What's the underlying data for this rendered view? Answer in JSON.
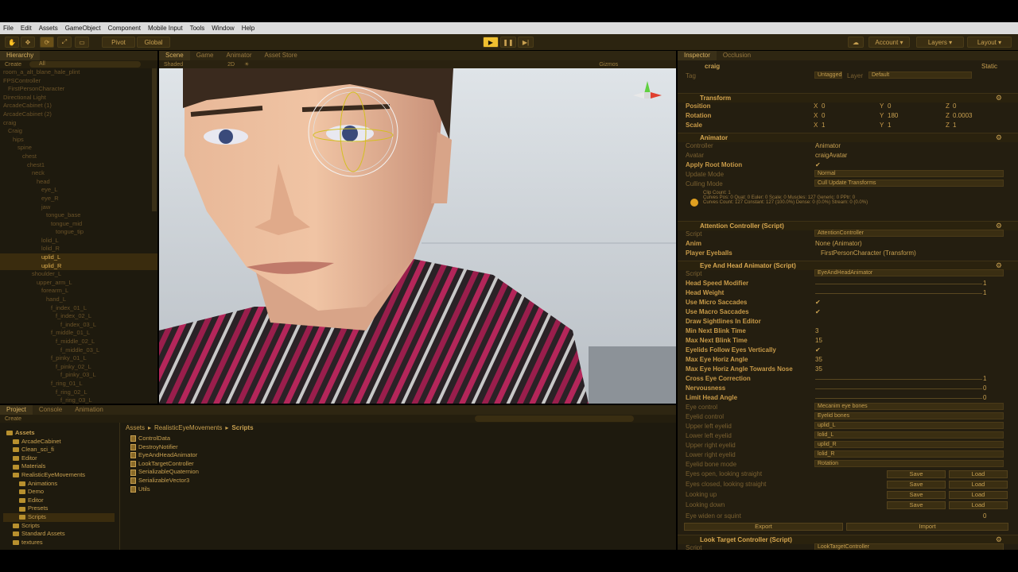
{
  "menubar": {
    "items": [
      "File",
      "Edit",
      "Assets",
      "GameObject",
      "Component",
      "Mobile Input",
      "Tools",
      "Window",
      "Help"
    ]
  },
  "toolbar": {
    "pivot": "Pivot",
    "global": "Global",
    "account": "Account",
    "layers": "Layers",
    "layout": "Layout"
  },
  "hierarchy": {
    "tab": "Hierarchy",
    "create": "Create",
    "search_placeholder": "All",
    "items": [
      {
        "label": "room_a_alt_blane_hale_plint",
        "indent": 0
      },
      {
        "label": "FPSController",
        "indent": 0
      },
      {
        "label": "FirstPersonCharacter",
        "indent": 1
      },
      {
        "label": "Directional Light",
        "indent": 0
      },
      {
        "label": "ArcadeCabinet (1)",
        "indent": 0
      },
      {
        "label": "ArcadeCabinet (2)",
        "indent": 0
      },
      {
        "label": "craig",
        "indent": 0
      },
      {
        "label": "Craig",
        "indent": 1
      },
      {
        "label": "hips",
        "indent": 2
      },
      {
        "label": "spine",
        "indent": 3
      },
      {
        "label": "chest",
        "indent": 4
      },
      {
        "label": "chest1",
        "indent": 5
      },
      {
        "label": "neck",
        "indent": 6
      },
      {
        "label": "head",
        "indent": 7
      },
      {
        "label": "eye_L",
        "indent": 8
      },
      {
        "label": "eye_R",
        "indent": 8
      },
      {
        "label": "jaw",
        "indent": 8
      },
      {
        "label": "tongue_base",
        "indent": 9
      },
      {
        "label": "tongue_mid",
        "indent": 10
      },
      {
        "label": "tongue_tip",
        "indent": 11
      },
      {
        "label": "lolid_L",
        "indent": 8
      },
      {
        "label": "lolid_R",
        "indent": 8
      },
      {
        "label": "uplid_L",
        "indent": 8,
        "selected": true
      },
      {
        "label": "uplid_R",
        "indent": 8,
        "selected": true
      },
      {
        "label": "shoulder_L",
        "indent": 6
      },
      {
        "label": "upper_arm_L",
        "indent": 7
      },
      {
        "label": "forearm_L",
        "indent": 8
      },
      {
        "label": "hand_L",
        "indent": 9
      },
      {
        "label": "f_index_01_L",
        "indent": 10
      },
      {
        "label": "f_index_02_L",
        "indent": 11
      },
      {
        "label": "f_index_03_L",
        "indent": 12
      },
      {
        "label": "f_middle_01_L",
        "indent": 10
      },
      {
        "label": "f_middle_02_L",
        "indent": 11
      },
      {
        "label": "f_middle_03_L",
        "indent": 12
      },
      {
        "label": "f_pinky_01_L",
        "indent": 10
      },
      {
        "label": "f_pinky_02_L",
        "indent": 11
      },
      {
        "label": "f_pinky_03_L",
        "indent": 12
      },
      {
        "label": "f_ring_01_L",
        "indent": 10
      },
      {
        "label": "f_ring_02_L",
        "indent": 11
      },
      {
        "label": "f_ring_03_L",
        "indent": 12
      }
    ]
  },
  "scene": {
    "tabs": [
      "Scene",
      "Game",
      "Animator",
      "Asset Store"
    ],
    "shaded": "Shaded",
    "mode_2d": "2D",
    "gizmos": "Gizmos"
  },
  "inspector": {
    "tabs": [
      "Inspector",
      "Occlusion"
    ],
    "object_name": "craig",
    "static": "Static",
    "tag_label": "Tag",
    "tag_value": "Untagged",
    "layer_label": "Layer",
    "layer_value": "Default",
    "transform": {
      "title": "Transform",
      "rows": [
        {
          "label": "Position",
          "x": "0",
          "y": "0",
          "z": "0"
        },
        {
          "label": "Rotation",
          "x": "0",
          "y": "180",
          "z": "0.0003"
        },
        {
          "label": "Scale",
          "x": "1",
          "y": "1",
          "z": "1"
        }
      ]
    },
    "animator": {
      "title": "Animator",
      "controller_label": "Controller",
      "controller": "Animator",
      "avatar_label": "Avatar",
      "avatar": "craigAvatar",
      "apply_root_motion": "Apply Root Motion",
      "update_mode_label": "Update Mode",
      "update_mode": "Normal",
      "culling_label": "Culling Mode",
      "culling": "Cull Update Transforms",
      "info1": "Clip Count: 1",
      "info2": "Curves Pos: 0 Quat: 0 Euler: 0 Scale: 0 Muscles: 127 Generic: 0 PPtr: 0",
      "info3": "Curves Count: 127 Constant: 127 (100.0%) Dense: 0 (0.0%) Stream: 0 (0.0%)"
    },
    "attention": {
      "title": "Attention Controller (Script)",
      "script_label": "Script",
      "script": "AttentionController",
      "anim_label": "Anim",
      "anim": "None (Animator)",
      "eyeballs_label": "Player Eyeballs",
      "eyeballs": "FirstPersonCharacter (Transform)"
    },
    "eyehead": {
      "title": "Eye And Head Animator (Script)",
      "script_label": "Script",
      "script": "EyeAndHeadAnimator",
      "rows": [
        {
          "label": "Head Speed Modifier",
          "value": "1"
        },
        {
          "label": "Head Weight",
          "value": "1"
        },
        {
          "label": "Use Micro Saccades",
          "value": "✔"
        },
        {
          "label": "Use Macro Saccades",
          "value": "✔"
        },
        {
          "label": "Draw Sightlines In Editor",
          "value": ""
        },
        {
          "label": "Min Next Blink Time",
          "value": "3"
        },
        {
          "label": "Max Next Blink Time",
          "value": "15"
        },
        {
          "label": "Eyelids Follow Eyes Vertically",
          "value": "✔"
        },
        {
          "label": "Max Eye Horiz Angle",
          "value": "35"
        },
        {
          "label": "Max Eye Horiz Angle Towards Nose",
          "value": "35"
        },
        {
          "label": "Cross Eye Correction",
          "value": "1"
        },
        {
          "label": "Nervousness",
          "value": "0"
        },
        {
          "label": "Limit Head Angle",
          "value": "0"
        }
      ],
      "eye_control_label": "Eye control",
      "eye_control": "Mecanim eye bones",
      "eyelid_control_label": "Eyelid control",
      "eyelid_control": "Eyelid bones",
      "lids": [
        {
          "label": "Upper left eyelid",
          "value": "uplid_L"
        },
        {
          "label": "Lower left eyelid",
          "value": "lolid_L"
        },
        {
          "label": "Upper right eyelid",
          "value": "uplid_R"
        },
        {
          "label": "Lower right eyelid",
          "value": "lolid_R"
        }
      ],
      "bone_mode_label": "Eyelid bone mode",
      "bone_mode": "Rotation",
      "poses": [
        "Eyes open, looking straight",
        "Eyes closed, looking straight",
        "Looking up",
        "Looking down"
      ],
      "save": "Save",
      "load": "Load",
      "widen_label": "Eye widen or squint",
      "widen": "0",
      "export": "Export",
      "import": "Import"
    },
    "looktarget": {
      "title": "Look Target Controller (Script)",
      "script_label": "Script",
      "script": "LookTargetController"
    }
  },
  "project": {
    "tabs": [
      "Project",
      "Console",
      "Animation"
    ],
    "create": "Create",
    "breadcrumb": [
      "Assets",
      "RealisticEyeMovements",
      "Scripts"
    ],
    "tree": [
      {
        "label": "Assets",
        "indent": 0,
        "bold": true
      },
      {
        "label": "ArcadeCabinet",
        "indent": 1
      },
      {
        "label": "Clean_sci_fi",
        "indent": 1
      },
      {
        "label": "Editor",
        "indent": 1
      },
      {
        "label": "Materials",
        "indent": 1
      },
      {
        "label": "RealisticEyeMovements",
        "indent": 1
      },
      {
        "label": "Animations",
        "indent": 2
      },
      {
        "label": "Demo",
        "indent": 2
      },
      {
        "label": "Editor",
        "indent": 2
      },
      {
        "label": "Presets",
        "indent": 2
      },
      {
        "label": "Scripts",
        "indent": 2,
        "selected": true
      },
      {
        "label": "Scripts",
        "indent": 1
      },
      {
        "label": "Standard Assets",
        "indent": 1
      },
      {
        "label": "textures",
        "indent": 1
      }
    ],
    "files": [
      "ControlData",
      "DestroyNotifier",
      "EyeAndHeadAnimator",
      "LookTargetController",
      "SerializableQuaternion",
      "SerializableVector3",
      "Utils"
    ]
  },
  "colors": {
    "accent": "#c8a050",
    "panel": "#1e1a0e",
    "toolbar": "#2c2410",
    "play": "#f0c030"
  }
}
